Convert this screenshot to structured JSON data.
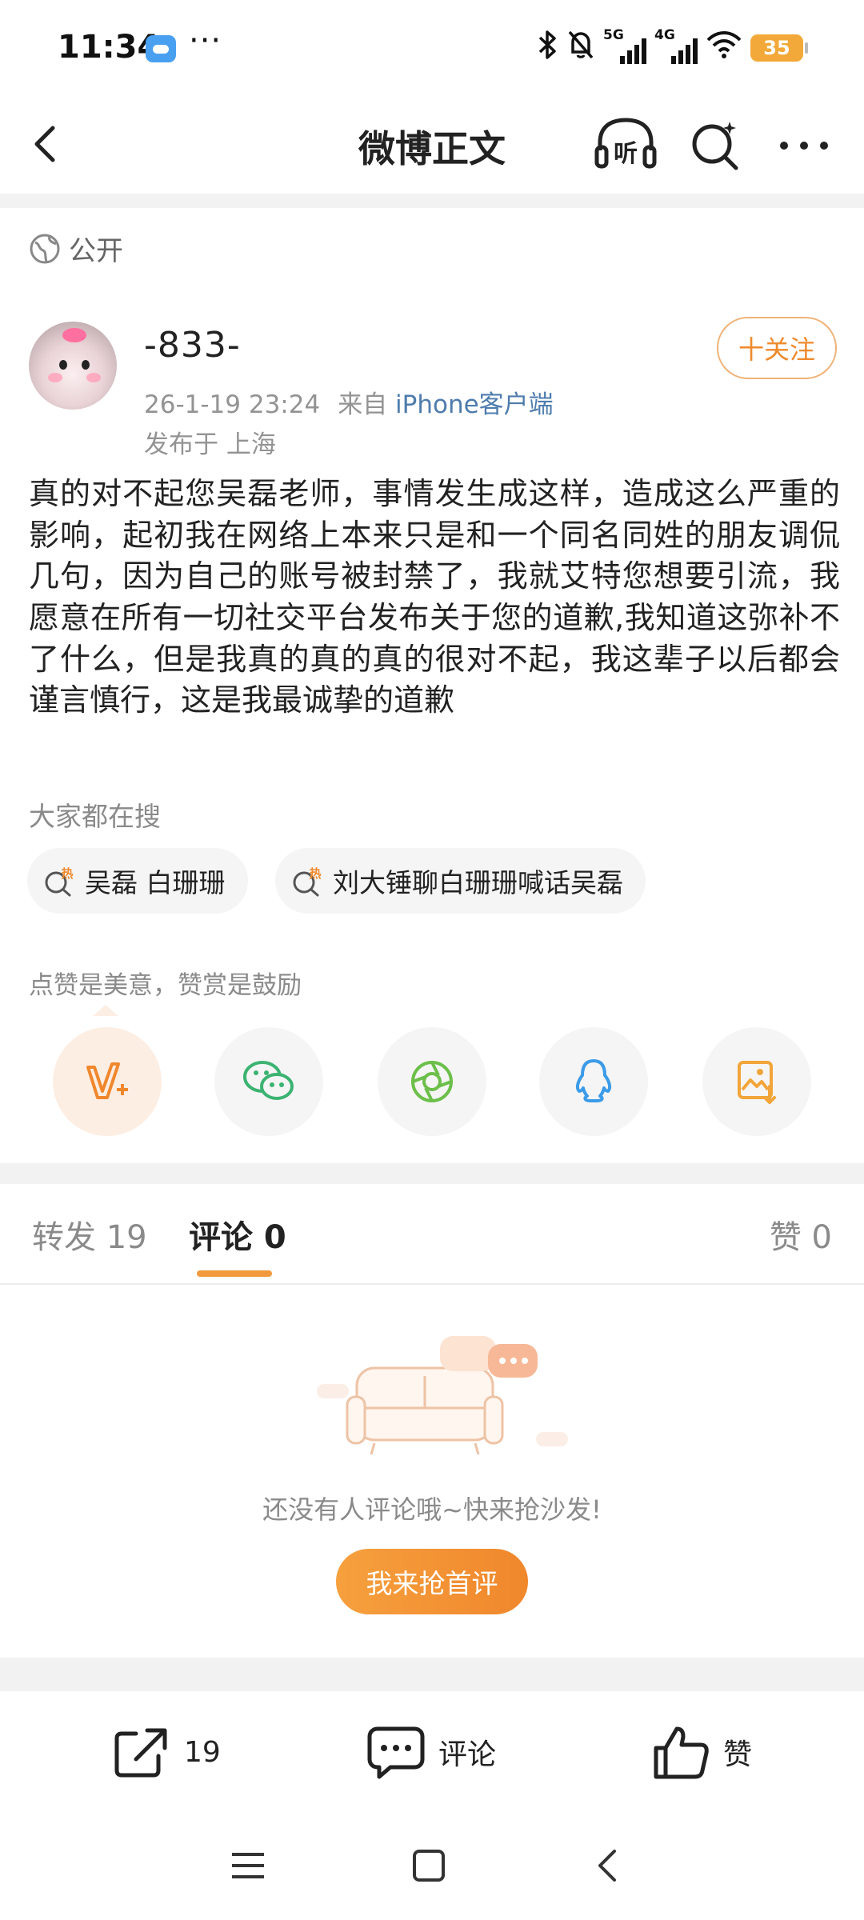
{
  "status_bar": {
    "time": "11:34",
    "dots": "···",
    "net_5g": "5G",
    "net_4g": "4G",
    "battery": "35"
  },
  "nav": {
    "title": "微博正文",
    "listen_label": "听"
  },
  "post": {
    "visibility": "公开",
    "author": "-833-",
    "follow_label": "十关注",
    "datetime": "26-1-19 23:24",
    "source_prefix": "来自",
    "source": "iPhone客户端",
    "location": "发布于 上海",
    "content": "真的对不起您吴磊老师，事情发生成这样，造成这么严重的影响，起初我在网络上本来只是和一个同名同姓的朋友调侃几句，因为自己的账号被封禁了，我就艾特您想要引流，我愿意在所有一切社交平台发布关于您的道歉,我知道这弥补不了什么，但是我真的真的真的很对不起，我这辈子以后都会谨言慎行，这是我最诚挚的道歉"
  },
  "trending": {
    "title": "大家都在搜",
    "hot_badge": "热",
    "items": [
      "吴磊 白珊珊",
      "刘大锤聊白珊珊喊话吴磊"
    ]
  },
  "share": {
    "tip": "点赞是美意，赞赏是鼓励",
    "items": [
      {
        "icon": "v-plus-icon",
        "color": "#f0872c"
      },
      {
        "icon": "wechat-icon",
        "color": "#3cb371"
      },
      {
        "icon": "moments-icon",
        "color": "#6cbf4a"
      },
      {
        "icon": "qq-icon",
        "color": "#3b9be8"
      },
      {
        "icon": "save-image-icon",
        "color": "#f2a53a"
      }
    ]
  },
  "tabs": {
    "repost": "转发 19",
    "comment": "评论 0",
    "like": "赞 0"
  },
  "empty": {
    "text": "还没有人评论哦~快来抢沙发!",
    "button": "我来抢首评"
  },
  "bottom_bar": {
    "share_count": "19",
    "comment": "评论",
    "like": "赞"
  },
  "colors": {
    "accent": "#f0872c",
    "link": "#4f7cad"
  }
}
